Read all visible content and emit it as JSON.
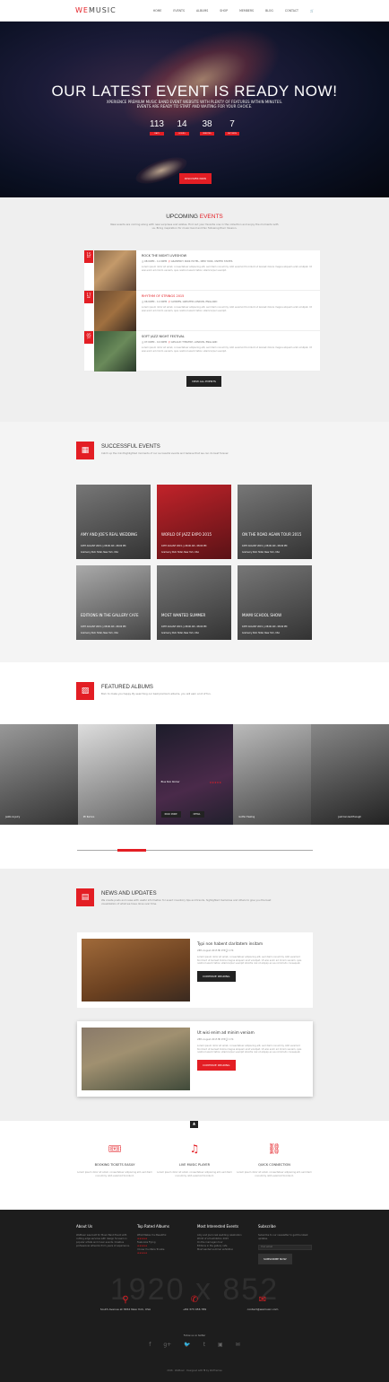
{
  "header": {
    "logo_a": "WE",
    "logo_b": "MUSIC",
    "nav": [
      "HOME",
      "EVENTS",
      "ALBUMS",
      "SHOP",
      "MEMBERS",
      "BLOG",
      "CONTACT"
    ],
    "cart": "🛒"
  },
  "hero": {
    "title": "OUR LATEST EVENT IS READY NOW!",
    "subtitle": "XPERIENCE PREMIUM MUSIC BAND EVENT WEBSITE WITH PLENTY OF FEATURES WITHIN MINUTES. EVENTS ARE READY TO START AND WAITING FOR YOUR CHOICE.",
    "countdown": [
      {
        "n": "113",
        "l": "DAYS"
      },
      {
        "n": "14",
        "l": "HOURS"
      },
      {
        "n": "38",
        "l": "MINUTES"
      },
      {
        "n": "7",
        "l": "SECONDS"
      }
    ],
    "button": "DISCOVER NOW"
  },
  "upcoming": {
    "title_a": "UPCOMING ",
    "title_b": "EVENTS",
    "desc": "New events are coming along with new surprises and sizzles. Find out your favorite one in the collection and enjoy the moments with us. Bring inspiration for music band and fan following their mission.",
    "events": [
      {
        "day": "15",
        "mon": "APR",
        "title": "ROCK THE NIGHT LIVESHOW",
        "time": "08:00PM - 11:00PM",
        "place": "GRAMERCY PARK HOTEL, NEW YORK, UNITED STATES",
        "desc": "Lorem ipsum dolor sit amet, consectetuer adipiscing elit, sed diam nonummy nibh euismod tincidunt ut laoreet dolore magna aliquam erat volutpat. Ut wisi enim ad minim veniam, quis nostrud exerci tation ullamcorper suscipit."
      },
      {
        "day": "17",
        "mon": "MAY",
        "title": "RHYTHM OF STRINGS 2015",
        "time": "06:00PM - 11:00PM",
        "place": "CAMDEN, GREATER LONDON, ENGLAND",
        "desc": "Lorem ipsum dolor sit amet, consectetuer adipiscing elit, sed diam nonummy nibh euismod tincidunt ut laoreet dolore magna aliquam erat volutpat. Ut wisi enim ad minim veniam, quis nostrud exerci tation ullamcorper suscipit."
      },
      {
        "day": "05",
        "mon": "JUN",
        "title": "SOFT JAZZ NIGHT FESTIVAL",
        "time": "07:00PM - 10:00PM",
        "place": "GIELGUD THEATRE, LONDON, ENGLAND",
        "desc": "Lorem ipsum dolor sit amet, consectetuer adipiscing elit, sed diam nonummy nibh euismod tincidunt ut laoreet dolore magna aliquam erat volutpat. Ut wisi enim ad minim veniam, quis nostrud exerci tation ullamcorper suscipit."
      }
    ],
    "button": "VIEW ALL EVENTS"
  },
  "successful": {
    "title": "SUCCESSFUL EVENTS",
    "desc": "Catch up the mindhighlighted moments of our successful events and believe that we can do best forever.",
    "items": [
      {
        "t": "AMY AND JOE'S REAL WEDDING",
        "m": "16TH AUGUST 2015  ◷ 08:00 AM - 08:00 PM",
        "l": "Gramercy Park Hotel, New York, USA"
      },
      {
        "t": "WORLD OF JAZZ EXPO 2015",
        "m": "16TH AUGUST 2015  ◷ 08:00 AM - 08:00 PM",
        "l": "Gramercy Park Hotel, New York, USA"
      },
      {
        "t": "ON THE ROAD AGAIN TOUR 2015",
        "m": "16TH AUGUST 2015  ◷ 08:00 AM - 08:00 PM",
        "l": "Gramercy Park Hotel, New York, USA"
      },
      {
        "t": "EDITIONS IN THE GALLERY CAFE",
        "m": "16TH AUGUST 2015  ◷ 08:00 AM - 08:00 PM",
        "l": "Gramercy Park Hotel, New York, USA"
      },
      {
        "t": "MOST WANTED SUMMER",
        "m": "16TH AUGUST 2015  ◷ 08:00 AM - 08:00 PM",
        "l": "Gramercy Park Hotel, New York, USA"
      },
      {
        "t": "MIAMI SCHOOL SHOW",
        "m": "16TH AUGUST 2015  ◷ 08:00 AM - 08:00 PM",
        "l": "Gramercy Park Hotel, New York, USA"
      }
    ]
  },
  "albums": {
    "title": "FEATURED ALBUMS",
    "desc": "Born to make you happy. By searching our best premium albums, you will earn a lot of fun.",
    "items": [
      "Justin & Jerry",
      "Mr Ramos",
      "Blue Skin Rocker",
      "Gothic Feeling",
      "Just Can Get Enough"
    ],
    "stars": "★★★★★",
    "read_more": "READ MORE",
    "detail": "DETAIL"
  },
  "news": {
    "title": "NEWS AND UPDATES",
    "desc": "We create posts and news with useful information for event inventory tips and trends, highlighted memories and others to give you the best visualization of what we have done over time.",
    "posts": [
      {
        "t": "Typi non habent claritatem insitam",
        "m": "28th August 2015   ♥ 278   💬 174",
        "d": "Lorem ipsum dolor sit amet, consectetuer adipiscing elit, sed diam nonummy nibh euismod tincidunt ut laoreet dolore magna aliquam erat volutpat. Ut wisi enim ad minim veniam, quis nostrud exerci tation ullamcorper suscipit lobortis nisl ut aliquip ex ea commodo consequat.",
        "b": "CONTINUE READING"
      },
      {
        "t": "Ut wisi enim ad minim veniam",
        "m": "28th August 2015   ♥ 278   💬 174",
        "d": "Lorem ipsum dolor sit amet, consectetuer adipiscing elit, sed diam nonummy nibh euismod tincidunt ut laoreet dolore magna aliquam erat volutpat. Ut wisi enim ad minim veniam, quis nostrud exerci tation ullamcorper suscipit lobortis nisl ut aliquip ex ea commodo consequat.",
        "b": "CONTINUE READING"
      }
    ]
  },
  "features": [
    {
      "t": "BOOKING TICKETS EASILY",
      "d": "Lorem ipsum dolor sit amet, consectetuer adipiscing elit, sed diam nonummy nibh euismod tincidunt."
    },
    {
      "t": "LIVE MUSIC PLAYER",
      "d": "Lorem ipsum dolor sit amet, consectetuer adipiscing elit, sed diam nonummy nibh euismod tincidunt."
    },
    {
      "t": "QUICK CONNECTION",
      "d": "Lorem ipsum dolor sit amet, consectetuer adipiscing elit, sed diam nonummy nibh euismod tincidunt."
    }
  ],
  "footer": {
    "about_t": "About Us",
    "about_d": "WeMusic was built for Music Band Event with cutting-edge services with design focused on popular artists and music events. Creative professional artworks from years of experience.",
    "top_t": "Top Rated Albums",
    "top": [
      "What Makes You Beautiful",
      "Feels Like Flying",
      "I Know You Were Trouble"
    ],
    "int_t": "Most Interested Events",
    "int": [
      "Amy and Joe's real wedding celebration",
      "World of art exhibition 2015",
      "On the road again tour",
      "Editions in the gallery cafe",
      "Most wanted summer exhibition"
    ],
    "sub_t": "Subscribe",
    "sub_d": "Subscribe to our newsletter to get the latest updates.",
    "sub_ph": "Your email",
    "sub_b": "SUBSCRIBE NOW",
    "big": "1920 x 852",
    "addr": "South Avenue at 3652 New York, USA",
    "phone": "+84 373 456 789",
    "email": "contact@wemusic.com",
    "follow": "Follow us on twitter",
    "social": [
      "f",
      "g+",
      "🐦",
      "t",
      "▣",
      "✉"
    ],
    "copy": "2016 · WeMusic · Designed with ♥ by WeThemes"
  }
}
